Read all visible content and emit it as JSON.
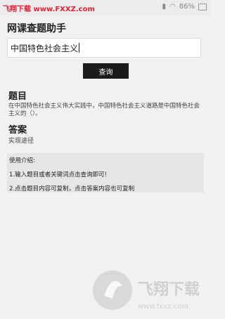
{
  "status_bar": {
    "watermark_text": "飞翔下载 www.FXXZ.com",
    "battery": "86%"
  },
  "app": {
    "title": "网课查题助手"
  },
  "search": {
    "value": "中国特色社会主义"
  },
  "search_button": {
    "label": "查询"
  },
  "question": {
    "heading": "题目",
    "text": "在中国特色社会主义伟大实践中，中国特色社会主义道路是中国特色社会主义的（）。"
  },
  "answer": {
    "heading": "答案",
    "text": "实现途径"
  },
  "usage": {
    "heading": "使用介绍:",
    "items": [
      "1.输入题目或者关键词点击查询即可!",
      "2.点击题目内容可复制，点击答案内容也可复制"
    ]
  },
  "watermark": {
    "brand": "飞翔下载",
    "url": "www.fxxz.com"
  }
}
